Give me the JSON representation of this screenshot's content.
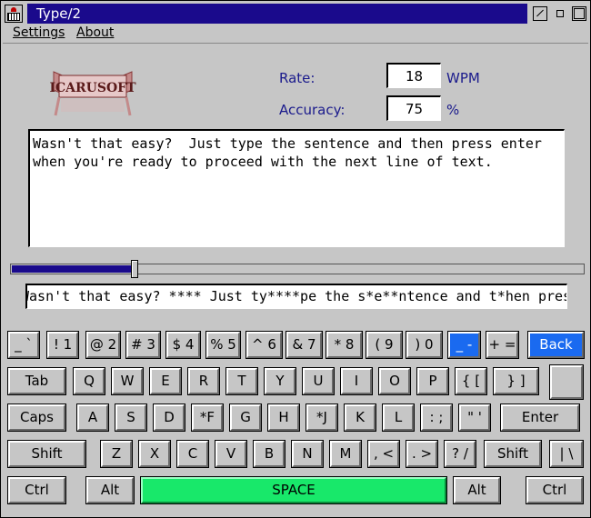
{
  "window": {
    "title": "Type/2"
  },
  "menubar": {
    "settings": "Settings",
    "about": "About"
  },
  "logo": {
    "text": "ICARUSOFT"
  },
  "stats": {
    "rate_label": "Rate:",
    "rate_value": "18",
    "rate_unit": "WPM",
    "accuracy_label": "Accuracy:",
    "accuracy_value": "75",
    "accuracy_unit": "%"
  },
  "lesson_text": "Wasn't that easy?  Just type the sentence and then press enter\nwhen you're ready to proceed with the next line of text.",
  "progress": {
    "fraction": 0.21
  },
  "typed_text": "Wasn't that easy? **** Just ty****pe the s*e**ntence and t*hen press",
  "keyboard": {
    "row1": [
      "_ `",
      "! 1",
      "@ 2",
      "# 3",
      "$ 4",
      "% 5",
      "^ 6",
      "& 7",
      "* 8",
      "( 9",
      ") 0",
      "_ -",
      "+ =",
      "Back"
    ],
    "row2": [
      "Tab",
      "Q",
      "W",
      "E",
      "R",
      "T",
      "Y",
      "U",
      "I",
      "O",
      "P",
      "{ [",
      "} ]",
      ""
    ],
    "row3": [
      "Caps",
      "A",
      "S",
      "D",
      "*F",
      "G",
      "H",
      "*J",
      "K",
      "L",
      ": ;",
      "\" '",
      "Enter"
    ],
    "row4": [
      "Shift",
      "Z",
      "X",
      "C",
      "V",
      "B",
      "N",
      "M",
      ", <",
      ". >",
      "? /",
      "Shift",
      "| \\"
    ],
    "row5": [
      "Ctrl",
      "Alt",
      "SPACE",
      "Alt",
      "Ctrl"
    ],
    "highlight_color": "#1a6af0",
    "space_color": "#18e86a"
  },
  "colors": {
    "titlebar": "#1a0a8c",
    "label": "#1a1a8c",
    "window_bg": "#c6c6c6"
  }
}
